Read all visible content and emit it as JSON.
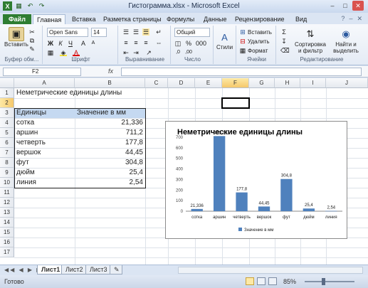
{
  "window": {
    "title": "Гистограмма.xlsx - Microsoft Excel",
    "qat_icons": [
      "excel-logo-icon",
      "save-icon",
      "undo-icon",
      "redo-icon"
    ]
  },
  "ribbon_tabs": [
    "Файл",
    "Главная",
    "Вставка",
    "Разметка страницы",
    "Формулы",
    "Данные",
    "Рецензирование",
    "Вид"
  ],
  "ribbon": {
    "paste_label": "Вставить",
    "font_name": "Open Sans",
    "font_size": "14",
    "number_format": "Общий",
    "styles_label": "Стили",
    "insert_label": "Вставить",
    "delete_label": "Удалить",
    "format_label": "Формат",
    "sort_label": "Сортировка и фильтр",
    "find_label": "Найти и выделить",
    "groups": [
      "Буфер обм...",
      "Шрифт",
      "Выравнивание",
      "Число",
      "Ячейки",
      "Редактирование"
    ]
  },
  "formula_bar": {
    "name_box": "F2",
    "fx": "fx",
    "value": ""
  },
  "columns": [
    "A",
    "B",
    "C",
    "D",
    "E",
    "F",
    "G",
    "H",
    "I",
    "J"
  ],
  "rows": [
    "1",
    "2",
    "3",
    "4",
    "5",
    "6",
    "7",
    "8",
    "9",
    "10",
    "11",
    "12",
    "13",
    "14",
    "15",
    "16",
    "17"
  ],
  "sheet": {
    "title": "Неметрические единицы длины",
    "header_unit": "Единицы",
    "header_value": "Значение в мм",
    "units": [
      "сотка",
      "аршин",
      "четверть",
      "вершок",
      "фут",
      "дюйм",
      "линия"
    ],
    "values": [
      "21,336",
      "711,2",
      "177,8",
      "44,45",
      "304,8",
      "25,4",
      "2,54"
    ]
  },
  "chart_data": {
    "type": "bar",
    "title": "Неметрические единицы длины",
    "categories": [
      "сотка",
      "аршин",
      "четверть",
      "вершок",
      "фут",
      "дюйм",
      "линия"
    ],
    "series": [
      {
        "name": "Значение в мм",
        "values": [
          21.336,
          711.2,
          177.8,
          44.45,
          304.8,
          25.4,
          2.54
        ]
      }
    ],
    "data_labels": [
      "21,336",
      "711,2",
      "177,8",
      "44,45",
      "304,8",
      "25,4",
      "2,54"
    ],
    "yticks": [
      "0",
      "100",
      "200",
      "300",
      "400",
      "500",
      "600",
      "700"
    ],
    "ylim": [
      0,
      700
    ],
    "legend": "bottom",
    "color": "#4f81bd"
  },
  "sheet_tabs": [
    "Лист1",
    "Лист2",
    "Лист3"
  ],
  "status": {
    "ready": "Готово",
    "zoom": "85%"
  }
}
